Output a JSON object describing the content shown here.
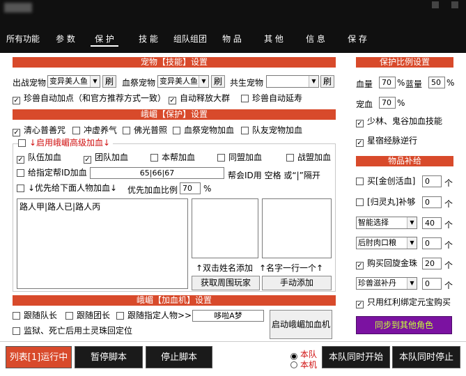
{
  "tabs": [
    "所有功能",
    "参 数",
    "保 护",
    "技 能",
    "组队组团",
    "物 品",
    "其 他",
    "信 息",
    "保 存"
  ],
  "pet_section": {
    "title": "宠物【技能】设置",
    "battle_pet_label": "出战宠物",
    "battle_pet_value": "变异美人鱼",
    "blood_pet_label": "血祭宠物",
    "blood_pet_value": "变异美人鱼",
    "shared_pet_label": "共生宠物",
    "shared_pet_value": "",
    "refresh": "刷",
    "opt1": "珍兽自动加点（和官方推荐方式一致）",
    "opt2": "自动释放大群",
    "opt3": "珍兽自动延寿"
  },
  "protect_section": {
    "title": "峨嵋【保护】设置",
    "opts": [
      "清心普善咒",
      "冲虚养气",
      "佛光普照",
      "血祭宠物加血",
      "队友宠物加血"
    ],
    "advanced_label": "↓启用峨嵋高级加血↓",
    "adv_opts": [
      "队伍加血",
      "团队加血",
      "本帮加血",
      "同盟加血",
      "战盟加血"
    ],
    "assign_label": "给指定帮ID加血",
    "assign_value": "65|66|67",
    "assign_hint": "帮会ID用 空格 或“|”隔开",
    "priority_label": "↓优先给下面人物加血↓",
    "ratio_label": "优先加血比例",
    "ratio_value": "70",
    "ratio_unit": "%",
    "names_value": "路人甲|路人已|路人丙",
    "dbl_hint": "↑双击姓名添加",
    "line_hint": "↑名字一行一个↑",
    "get_players": "获取周围玩家",
    "manual_add": "手动添加"
  },
  "blood_machine": {
    "title": "峨嵋【加血机】设置",
    "opt1": "跟随队长",
    "opt2": "跟随团长",
    "opt3": "跟随指定人物>>>",
    "target_value": "哆啦A梦",
    "start_btn": "启动峨嵋加血机",
    "opt4": "监狱、死亡后用土灵珠回定位"
  },
  "ratio_panel": {
    "title": "保护比例设置",
    "hp_label": "血量",
    "hp_value": "70",
    "mp_label": "蓝量",
    "mp_value": "50",
    "pet_label": "宠血",
    "pet_value": "70",
    "unit": "%",
    "opt1": "少林、鬼谷加血技能",
    "opt2": "星宿经脉逆行"
  },
  "supply_panel": {
    "title": "物品补给",
    "row1_label": "买[金创活血]",
    "row1_value": "0",
    "row2_label": "[归灵丸]补够",
    "row2_value": "0",
    "row3_select": "智能选择",
    "row3_value": "40",
    "row4_select": "后肘肉口粮",
    "row4_value": "0",
    "row5_label": "购买回旋金珠",
    "row5_value": "20",
    "row6_select": "珍兽滋补丹",
    "row6_value": "0",
    "unit": "个",
    "opt_bound": "只用红利绑定元宝购买",
    "sync_btn": "同步到其他角色"
  },
  "bottom": {
    "status": "列表[1]运行中",
    "pause": "暂停脚本",
    "stop": "停止脚本",
    "radio1": "本队",
    "radio2": "本机",
    "start_all": "本队同时开始",
    "stop_all": "本队同时停止"
  },
  "colors": {
    "accent_red": "#d84a2b",
    "sync_purple": "#7b12a1"
  }
}
